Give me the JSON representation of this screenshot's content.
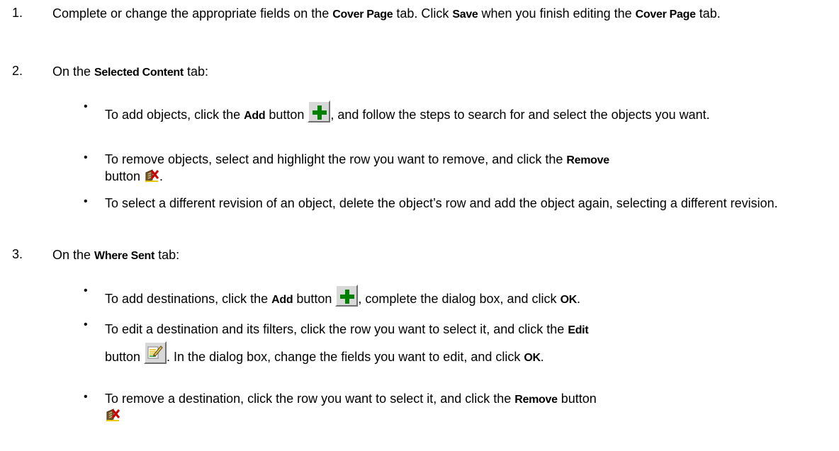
{
  "steps": [
    {
      "number": "1.",
      "t1": "Complete or change the appropriate fields on the ",
      "b1": "Cover Page",
      "t2": " tab. Click ",
      "b2": "Save",
      "t3": " when you finish editing the ",
      "b3": "Cover Page",
      "t4": " tab."
    },
    {
      "number": "2.",
      "t1": "On the ",
      "b1": "Selected Content",
      "t2": " tab:",
      "bullets": [
        {
          "t1": "To add objects, click the ",
          "b1": "Add",
          "t2": " button ",
          "icon": "add-plus-icon",
          "t3": ", and follow the steps to search for and select the objects you want."
        },
        {
          "t1": "To remove objects, select and highlight the row you want to remove, and click the ",
          "b1": "Remove",
          "t2": " button ",
          "icon": "remove-icon",
          "t3": "."
        },
        {
          "t1": "To select a different revision of an object, delete the object’s row and add the object again, selecting a different revision."
        }
      ]
    },
    {
      "number": "3.",
      "t1": "On the ",
      "b1": "Where Sent",
      "t2": " tab:",
      "bullets": [
        {
          "t1": "To add destinations, click the ",
          "b1": "Add",
          "t2": " button ",
          "icon": "add-plus-icon",
          "t3": ", complete the dialog box, and click ",
          "b2": "OK",
          "t4": "."
        },
        {
          "t1": "To edit a destination and its filters, click the row you want to select it, and click the ",
          "b1": "Edit",
          "t2": " button ",
          "icon": "edit-icon",
          "t3": ". In the dialog box, change the fields you want to edit, and click ",
          "b2": "OK",
          "t4": "."
        },
        {
          "t1": "To remove a destination, click the row you want to select it, and click the ",
          "b1": "Remove",
          "t2": " button",
          "icon": "remove-icon"
        }
      ]
    }
  ],
  "bullet_glyph": "•",
  "colors": {
    "add_plus": "#008000",
    "button_face": "#d8d8d8"
  }
}
